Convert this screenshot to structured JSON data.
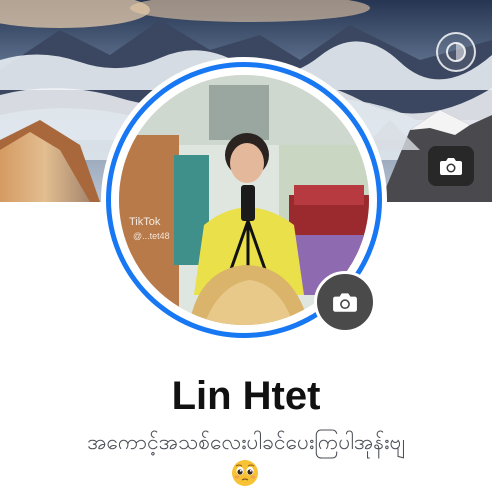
{
  "profile": {
    "name": "Lin Htet",
    "bio": "အကောင့်အသစ်လေးပါခင်ပေးကြပါအုန်းဗျ",
    "bio_emoji_name": "pleading-face-emoji"
  },
  "photo": {
    "watermark_app": "TikTok",
    "watermark_user": "@...tet48"
  },
  "colors": {
    "ring_blue": "#1877f2",
    "camera_button_bg": "#4a4a4a",
    "name_text": "#111111",
    "bio_text": "#4b4f56"
  },
  "icons": {
    "cover_camera": "camera-icon",
    "avatar_camera": "camera-icon",
    "top_right": "half-circle-icon"
  }
}
